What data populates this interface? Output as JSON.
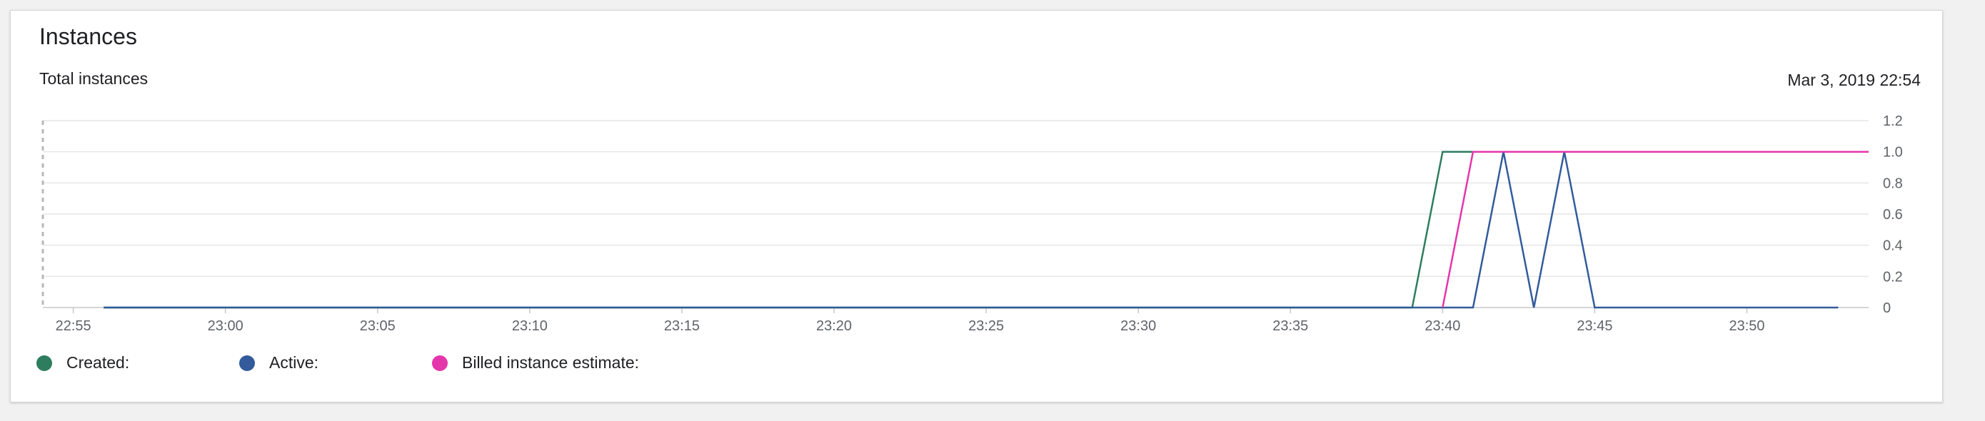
{
  "card": {
    "title": "Instances",
    "subtitle": "Total instances",
    "timestamp": "Mar 3, 2019 22:54"
  },
  "legend": [
    {
      "label": "Created:",
      "color": "#2e7d5e"
    },
    {
      "label": "Active:",
      "color": "#335b9c"
    },
    {
      "label": "Billed instance estimate:",
      "color": "#e535ab"
    }
  ],
  "chart_data": {
    "type": "line",
    "x_ticks": [
      "22:55",
      "23:00",
      "23:05",
      "23:10",
      "23:15",
      "23:20",
      "23:25",
      "23:30",
      "23:35",
      "23:40",
      "23:45",
      "23:50"
    ],
    "x_tick_minutes": [
      -5,
      0,
      5,
      10,
      15,
      20,
      25,
      30,
      35,
      40,
      45,
      50
    ],
    "y_ticks": [
      "0",
      "0.2",
      "0.4",
      "0.6",
      "0.8",
      "1.0",
      "1.2"
    ],
    "y_tick_values": [
      0,
      0.2,
      0.4,
      0.6,
      0.8,
      1.0,
      1.2
    ],
    "xlim": [
      "22:54",
      "23:54"
    ],
    "ylim": [
      0,
      1.2
    ],
    "grid": true,
    "legend_position": "bottom-left",
    "series": [
      {
        "name": "Created:",
        "color": "#2e7d5e",
        "x": [
          "22:56",
          "23:39",
          "23:40",
          "23:53"
        ],
        "y": [
          0,
          0,
          1,
          1
        ]
      },
      {
        "name": "Active:",
        "color": "#335b9c",
        "x": [
          "22:56",
          "23:41",
          "23:42",
          "23:43",
          "23:44",
          "23:45",
          "23:53"
        ],
        "y": [
          0,
          0,
          1,
          0,
          1,
          0,
          0
        ]
      },
      {
        "name": "Billed instance estimate:",
        "color": "#e535ab",
        "x": [
          "23:40",
          "23:41",
          "23:54"
        ],
        "y": [
          0,
          1,
          1
        ]
      }
    ]
  }
}
